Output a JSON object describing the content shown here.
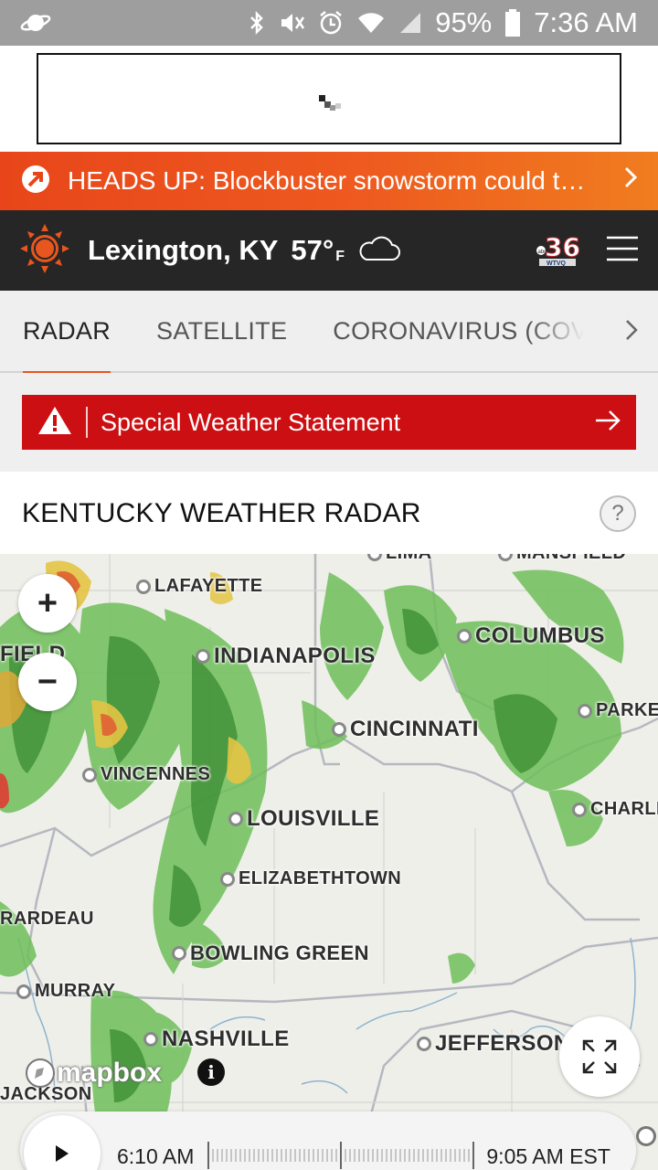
{
  "status_bar": {
    "battery": "95%",
    "time": "7:36 AM",
    "icons": [
      "saturn-icon",
      "bluetooth-icon",
      "mute-vibrate-icon",
      "alarm-icon",
      "wifi-icon",
      "signal-icon",
      "battery-icon"
    ]
  },
  "banner": {
    "text": "HEADS UP: Blockbuster snowstorm could t…",
    "icon": "arrow-badge-icon"
  },
  "header": {
    "location": "Lexington, KY",
    "temperature": "57°",
    "unit": "F",
    "weather_icon": "cloud-icon",
    "station_logo_text": "36",
    "station_call": "WTVQ",
    "network": "abc"
  },
  "tabs": [
    {
      "label": "RADAR",
      "active": true
    },
    {
      "label": "SATELLITE",
      "active": false
    },
    {
      "label": "CORONAVIRUS (COVID-",
      "active": false
    }
  ],
  "alert": {
    "text": "Special Weather Statement",
    "color": "#cc0f12"
  },
  "section": {
    "title": "KENTUCKY WEATHER RADAR",
    "help": "?"
  },
  "map": {
    "cities": {
      "lima": "LIMA",
      "mansfield": "MANSFIELD",
      "lafayette": "LAFAYETTE",
      "columbus": "COLUMBUS",
      "springfield": "FIELD",
      "indianapolis": "INDIANAPOLIS",
      "parkersburg": "PARKE",
      "cincinnati": "CINCINNATI",
      "vincennes": "VINCENNES",
      "louisville": "LOUISVILLE",
      "charleston": "CHARLE",
      "elizabethtown": "ELIZABETHTOWN",
      "girardeau": "RARDEAU",
      "bowling_green": "BOWLING GREEN",
      "murray": "MURRAY",
      "nashville": "NASHVILLE",
      "jefferson_city": "JEFFERSON C",
      "jackson": "JACKSON"
    },
    "zoom_in": "+",
    "zoom_out": "−",
    "attribution": "mapbox",
    "info": "i"
  },
  "timeline": {
    "start_time": "6:10 AM",
    "end_time": "9:05 AM EST"
  },
  "colors": {
    "orange_accent": "#e8561f",
    "header_bg": "#262626",
    "alert_red": "#cc0f12"
  }
}
